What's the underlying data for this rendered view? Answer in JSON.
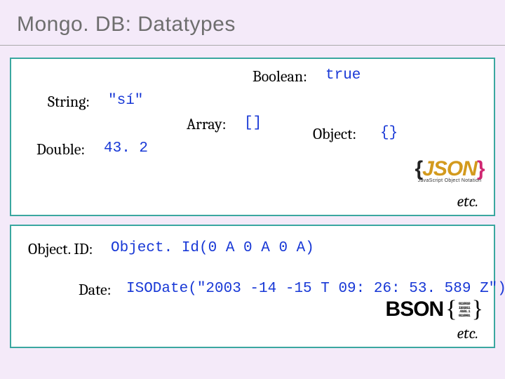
{
  "slide": {
    "title": "Mongo. DB: Datatypes",
    "top": {
      "boolean": {
        "label": "Boolean:",
        "value": "true"
      },
      "string": {
        "label": "String:",
        "value": "\"sí\""
      },
      "array": {
        "label": "Array:",
        "value": "[]"
      },
      "object": {
        "label": "Object:",
        "value": "{}"
      },
      "double": {
        "label": "Double:",
        "value": "43. 2"
      },
      "json_logo": {
        "text": "JSON",
        "subtitle": "JavaScript Object Notation"
      },
      "etc": "etc."
    },
    "bottom": {
      "objectid": {
        "label": "Object. ID:",
        "value": "Object. Id(0 A 0 A 0 A)"
      },
      "date": {
        "label": "Date:",
        "value": "ISODate(\"2003 -14 -15 T 09: 26: 53. 589 Z\")"
      },
      "bson_logo": {
        "text": "BSON",
        "bits": "0110010\n1101011\n.0101.1\n0110001"
      },
      "etc": "etc."
    }
  }
}
